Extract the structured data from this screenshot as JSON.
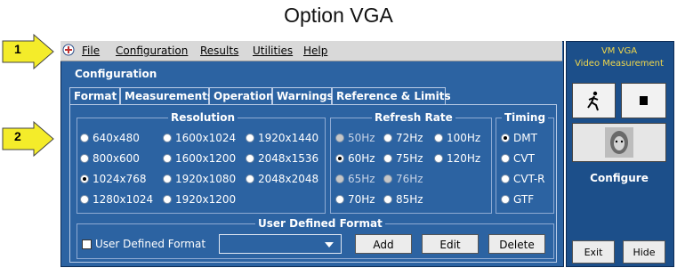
{
  "page_title": "Option VGA",
  "callouts": [
    "1",
    "2"
  ],
  "menu": [
    "File",
    "Configuration",
    "Results",
    "Utilities",
    "Help"
  ],
  "section_title": "Configuration",
  "tabs": [
    "Format",
    "Measurements",
    "Operation",
    "Warnings",
    "Reference & Limits"
  ],
  "resolution": {
    "title": "Resolution",
    "options": [
      "640x480",
      "1600x1024",
      "1920x1440",
      "800x600",
      "1600x1200",
      "2048x1536",
      "1024x768",
      "1920x1080",
      "2048x2048",
      "1280x1024",
      "1920x1200"
    ],
    "selected": "1024x768"
  },
  "refresh": {
    "title": "Refresh Rate",
    "options": [
      "50Hz",
      "72Hz",
      "100Hz",
      "60Hz",
      "75Hz",
      "120Hz",
      "65Hz",
      "76Hz",
      "70Hz",
      "85Hz"
    ],
    "selected": "60Hz"
  },
  "timing": {
    "title": "Timing",
    "options": [
      "DMT",
      "CVT",
      "CVT-R",
      "GTF"
    ],
    "selected": "DMT"
  },
  "user_defined": {
    "title": "User Defined Format",
    "checkbox_label": "User Defined Format",
    "buttons": [
      "Add",
      "Edit",
      "Delete"
    ]
  },
  "side_panel": {
    "title_line1": "VM VGA",
    "title_line2": "Video Measurement",
    "configure_label": "Configure",
    "exit_label": "Exit",
    "hide_label": "Hide"
  }
}
